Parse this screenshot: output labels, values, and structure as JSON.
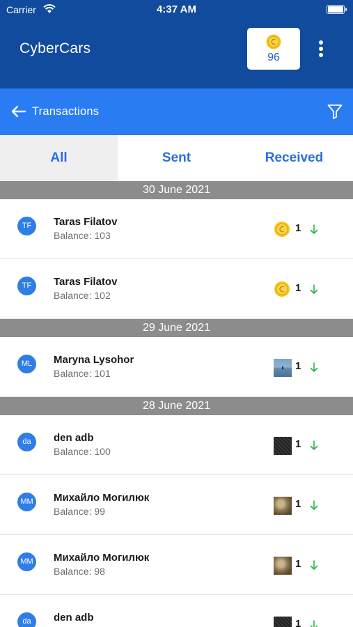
{
  "status_bar": {
    "carrier": "Carrier",
    "time": "4:37 AM"
  },
  "header": {
    "app_title": "CyberCars",
    "coins": "96"
  },
  "subheader": {
    "title": "Transactions"
  },
  "tabs": [
    {
      "label": "All",
      "active": true
    },
    {
      "label": "Sent",
      "active": false
    },
    {
      "label": "Received",
      "active": false
    }
  ],
  "colors": {
    "header": "#114b9d",
    "subheader": "#2a7cf3",
    "tab_text": "#2a6fdb",
    "avatar": "#2f7de6",
    "date_bar": "#8c8c8c",
    "arrow_green": "#2fb24c",
    "coin": "#f5c518"
  },
  "groups": [
    {
      "date": "30 June 2021",
      "rows": [
        {
          "initials": "TF",
          "name": "Taras Filatov",
          "balance": "Balance: 103",
          "icon": "coin-icon",
          "amount": "1"
        },
        {
          "initials": "TF",
          "name": "Taras Filatov",
          "balance": "Balance: 102",
          "icon": "coin-icon",
          "amount": "1"
        }
      ]
    },
    {
      "date": "29 June 2021",
      "rows": [
        {
          "initials": "ML",
          "name": "Maryna Lysohor",
          "balance": "Balance: 101",
          "icon": "lake-thumbnail",
          "amount": "1"
        }
      ]
    },
    {
      "date": "28 June 2021",
      "rows": [
        {
          "initials": "da",
          "name": "den adb",
          "balance": "Balance: 100",
          "icon": "dark-thumbnail",
          "amount": "1"
        },
        {
          "initials": "MM",
          "name": "Михайло Могилюк",
          "balance": "Balance: 99",
          "icon": "tree-thumbnail",
          "amount": "1"
        },
        {
          "initials": "MM",
          "name": "Михайло Могилюк",
          "balance": "Balance: 98",
          "icon": "tree-thumbnail",
          "amount": "1"
        },
        {
          "initials": "da",
          "name": "den adb",
          "balance": "",
          "icon": "dark-thumbnail",
          "amount": "1"
        }
      ]
    }
  ]
}
